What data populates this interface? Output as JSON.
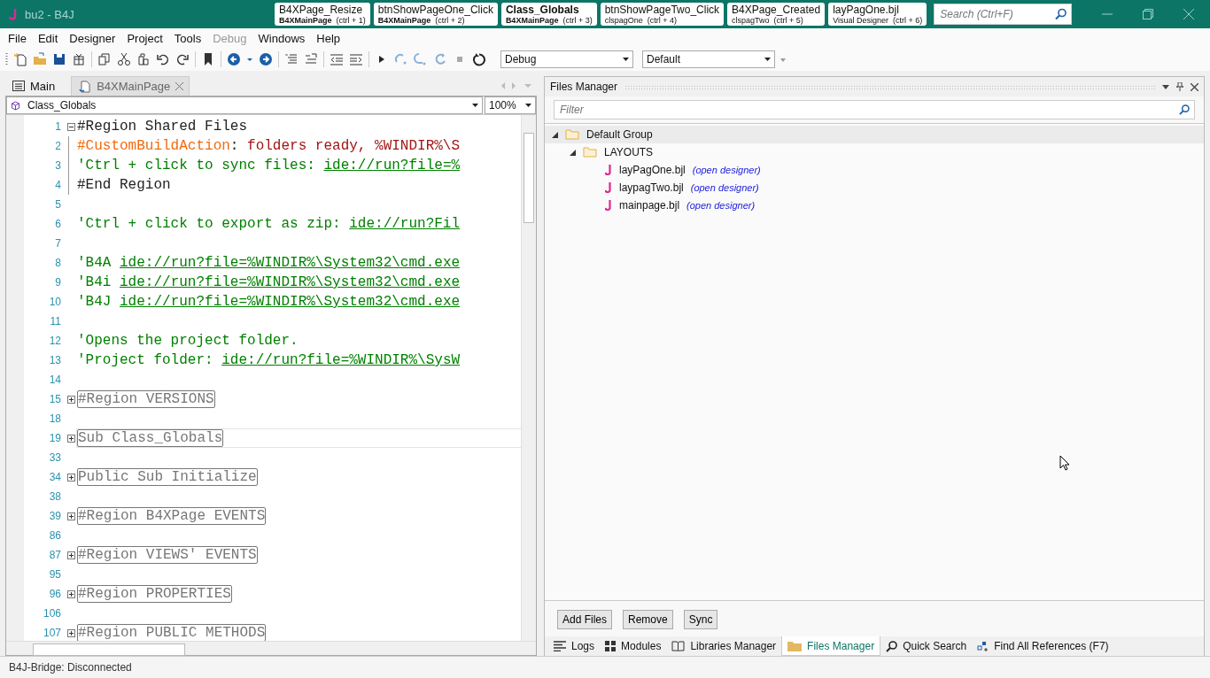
{
  "window": {
    "title": "bu2 - B4J"
  },
  "quick_tabs": [
    {
      "title": "B4XPage_Resize",
      "module": "B4XMainPage",
      "shortcut": "(ctrl + 1)",
      "selected": false,
      "in_current_module": true
    },
    {
      "title": "btnShowPageOne_Click",
      "module": "B4XMainPage",
      "shortcut": "(ctrl + 2)",
      "selected": false,
      "in_current_module": true
    },
    {
      "title": "Class_Globals",
      "module": "B4XMainPage",
      "shortcut": "(ctrl + 3)",
      "selected": true,
      "in_current_module": true
    },
    {
      "title": "btnShowPageTwo_Click",
      "module": "clspagOne",
      "shortcut": "(ctrl + 4)",
      "selected": false,
      "in_current_module": false
    },
    {
      "title": "B4XPage_Created",
      "module": "clspagTwo",
      "shortcut": "(ctrl + 5)",
      "selected": false,
      "in_current_module": false
    },
    {
      "title": "layPagOne.bjl",
      "module": "Visual Designer",
      "shortcut": "(ctrl + 6)",
      "selected": false,
      "in_current_module": false
    }
  ],
  "search": {
    "placeholder": "Search (Ctrl+F)"
  },
  "menu": [
    {
      "label": "File",
      "disabled": false
    },
    {
      "label": "Edit",
      "disabled": false
    },
    {
      "label": "Designer",
      "disabled": false
    },
    {
      "label": "Project",
      "disabled": false
    },
    {
      "label": "Tools",
      "disabled": false
    },
    {
      "label": "Debug",
      "disabled": true
    },
    {
      "label": "Windows",
      "disabled": false
    },
    {
      "label": "Help",
      "disabled": false
    }
  ],
  "toolbar": {
    "build_config": "Debug",
    "profile": "Default"
  },
  "editor_tabs": [
    {
      "label": "Main",
      "selected": false
    },
    {
      "label": "B4XMainPage",
      "selected": true
    }
  ],
  "editor": {
    "module": "Class_Globals",
    "zoom": "100%",
    "lines": [
      {
        "number": "1",
        "collapsed": false,
        "guide": false,
        "current": false,
        "parts": [
          {
            "kind": "directive",
            "text": "#Region Shared Files"
          }
        ]
      },
      {
        "number": "2",
        "guide": true,
        "current": false,
        "parts": [
          {
            "kind": "attribute",
            "text": "#CustomBuildAction"
          },
          {
            "kind": "plain",
            "text": ": "
          },
          {
            "kind": "string",
            "text": "folders ready, %WINDIR%\\S"
          }
        ]
      },
      {
        "number": "3",
        "guide": true,
        "current": false,
        "parts": [
          {
            "kind": "comment",
            "text": "'Ctrl + click to sync files: "
          },
          {
            "kind": "link",
            "text": "ide://run?file=%"
          }
        ]
      },
      {
        "number": "4",
        "guide": true,
        "current": false,
        "parts": [
          {
            "kind": "directive",
            "text": "#End Region"
          }
        ]
      },
      {
        "number": "5",
        "guide": false,
        "current": false
      },
      {
        "number": "6",
        "guide": false,
        "current": false,
        "parts": [
          {
            "kind": "comment",
            "text": "'Ctrl + click to export as zip: "
          },
          {
            "kind": "link",
            "text": "ide://run?Fil"
          }
        ]
      },
      {
        "number": "7",
        "guide": false,
        "current": false
      },
      {
        "number": "8",
        "guide": false,
        "current": false,
        "parts": [
          {
            "kind": "comment",
            "text": "'B4A "
          },
          {
            "kind": "link",
            "text": "ide://run?file=%WINDIR%\\System32\\cmd.exe"
          }
        ]
      },
      {
        "number": "9",
        "guide": false,
        "current": false,
        "parts": [
          {
            "kind": "comment",
            "text": "'B4i "
          },
          {
            "kind": "link",
            "text": "ide://run?file=%WINDIR%\\System32\\cmd.exe"
          }
        ]
      },
      {
        "number": "10",
        "guide": false,
        "current": false,
        "parts": [
          {
            "kind": "comment",
            "text": "'B4J "
          },
          {
            "kind": "link",
            "text": "ide://run?file=%WINDIR%\\System32\\cmd.exe"
          }
        ]
      },
      {
        "number": "11",
        "guide": false,
        "current": false
      },
      {
        "number": "12",
        "guide": false,
        "current": false,
        "parts": [
          {
            "kind": "comment",
            "text": "'Opens the project folder."
          }
        ]
      },
      {
        "number": "13",
        "guide": false,
        "current": false,
        "parts": [
          {
            "kind": "comment",
            "text": "'Project folder: "
          },
          {
            "kind": "link",
            "text": "ide://run?file=%WINDIR%\\SysW"
          }
        ]
      },
      {
        "number": "14",
        "guide": false,
        "current": false
      },
      {
        "number": "15",
        "collapsed": true,
        "guide": false,
        "current": false,
        "parts": [
          {
            "kind": "folded",
            "text": "#Region VERSIONS"
          }
        ]
      },
      {
        "number": "18",
        "guide": false,
        "current": false
      },
      {
        "number": "19",
        "collapsed": true,
        "guide": false,
        "current": true,
        "parts": [
          {
            "kind": "folded",
            "text": "Sub Class_Globals"
          }
        ]
      },
      {
        "number": "33",
        "guide": false,
        "current": false
      },
      {
        "number": "34",
        "collapsed": true,
        "guide": false,
        "current": false,
        "parts": [
          {
            "kind": "folded",
            "text": "Public Sub Initialize"
          }
        ]
      },
      {
        "number": "38",
        "guide": false,
        "current": false
      },
      {
        "number": "39",
        "collapsed": true,
        "guide": false,
        "current": false,
        "parts": [
          {
            "kind": "folded",
            "text": "#Region B4XPage EVENTS"
          }
        ]
      },
      {
        "number": "86",
        "guide": false,
        "current": false
      },
      {
        "number": "87",
        "collapsed": true,
        "guide": false,
        "current": false,
        "parts": [
          {
            "kind": "folded",
            "text": "#Region VIEWS' EVENTS"
          }
        ]
      },
      {
        "number": "95",
        "guide": false,
        "current": false
      },
      {
        "number": "96",
        "collapsed": true,
        "guide": false,
        "current": false,
        "parts": [
          {
            "kind": "folded",
            "text": "#Region PROPERTIES"
          }
        ]
      },
      {
        "number": "106",
        "guide": false,
        "current": false
      },
      {
        "number": "107",
        "collapsed": true,
        "guide": false,
        "current": false,
        "parts": [
          {
            "kind": "folded",
            "text": "#Region PUBLIC METHODS"
          }
        ]
      }
    ]
  },
  "files_manager": {
    "title": "Files Manager",
    "filter_placeholder": "Filter",
    "tree": [
      {
        "label": "Default Group",
        "kind": "folder",
        "expanded": true,
        "selected": true,
        "children": [
          {
            "label": "LAYOUTS",
            "kind": "folder",
            "expanded": true,
            "selected": false,
            "children": [
              {
                "label": "layPagOne.bjl",
                "kind": "file",
                "action": "(open designer)",
                "selected": false
              },
              {
                "label": "laypagTwo.bjl",
                "kind": "file",
                "action": "(open designer)",
                "selected": false
              },
              {
                "label": "mainpage.bjl",
                "kind": "file",
                "action": "(open designer)",
                "selected": false
              }
            ]
          }
        ]
      }
    ],
    "buttons": [
      "Add Files",
      "Remove",
      "Sync"
    ]
  },
  "bottom_tabs": [
    {
      "label": "Logs",
      "kind": "logs",
      "selected": false
    },
    {
      "label": "Modules",
      "kind": "modules",
      "selected": false
    },
    {
      "label": "Libraries Manager",
      "kind": "libraries",
      "selected": false
    },
    {
      "label": "Files Manager",
      "kind": "files",
      "selected": true
    },
    {
      "label": "Quick Search",
      "kind": "search",
      "selected": false
    },
    {
      "label": "Find All References (F7)",
      "kind": "references",
      "selected": false
    }
  ],
  "status_bar": "B4J-Bridge: Disconnected"
}
